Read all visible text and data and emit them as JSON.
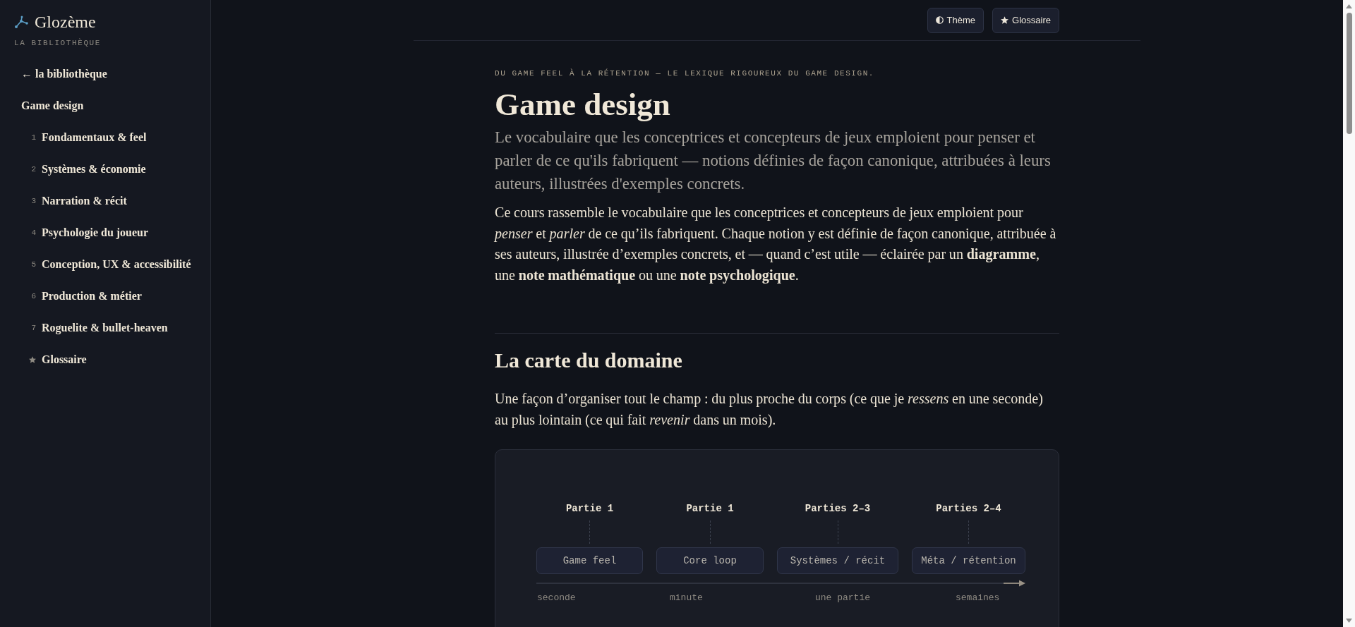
{
  "sidebar": {
    "brand": {
      "name": "Glozème",
      "subtitle": "LA BIBLIOTHÈQUE"
    },
    "back_link": "← la bibliothèque",
    "section_title": "Game design",
    "items": [
      {
        "kind": "chapter",
        "number": "1",
        "label": "Fondamentaux & feel"
      },
      {
        "kind": "chapter",
        "number": "2",
        "label": "Systèmes & économie"
      },
      {
        "kind": "chapter",
        "number": "3",
        "label": "Narration & récit"
      },
      {
        "kind": "chapter",
        "number": "4",
        "label": "Psychologie du joueur"
      },
      {
        "kind": "chapter",
        "number": "5",
        "label": "Conception, UX & accessibilité"
      },
      {
        "kind": "chapter",
        "number": "6",
        "label": "Production & métier"
      },
      {
        "kind": "chapter",
        "number": "7",
        "label": "Roguelite & bullet-heaven"
      },
      {
        "kind": "glossary",
        "label": "Glossaire"
      }
    ]
  },
  "toolbar": {
    "buttons": [
      {
        "kind": "theme",
        "label": "Thème"
      },
      {
        "kind": "glossary",
        "label": "Glossaire"
      }
    ]
  },
  "article": {
    "eyebrow": "DU GAME FEEL À LA RÉTENTION — LE LEXIQUE RIGOUREUX DU GAME DESIGN.",
    "title": "Game design",
    "lead": "Le vocabulaire que les conceptrices et concepteurs de jeux emploient pour penser et parler de ce qu'ils fabriquent — notions définies de façon canonique, attribuées à leurs auteurs, illustrées d'exemples concrets.",
    "intro": "Ce cours rassemble le vocabulaire que les conceptrices et concepteurs de jeux emploient pour *penser* et *parler* de ce qu’ils fabriquent. Chaque notion y est définie de façon canonique, attribuée à ses auteurs, illustrée d’exemples concrets, et — quand c’est utile — éclairée par un **diagramme**, une **note mathématique** ou une **note psychologique**.",
    "sections": [
      {
        "heading": "La carte du domaine",
        "text": "Une façon d’organiser tout le champ : du plus proche du corps (ce que je *ressens* en une seconde) au plus lointain (ce qui fait *revenir* dans un mois).",
        "diagram": {
          "columns": [
            {
              "part": "Partie 1",
              "stage": "Game feel",
              "scale": "seconde"
            },
            {
              "part": "Partie 1",
              "stage": "Core loop",
              "scale": "minute"
            },
            {
              "part": "Parties 2–3",
              "stage": "Systèmes / récit",
              "scale": "une partie"
            },
            {
              "part": "Parties 2–4",
              "stage": "Méta / rétention",
              "scale": "semaines"
            }
          ]
        }
      }
    ]
  }
}
